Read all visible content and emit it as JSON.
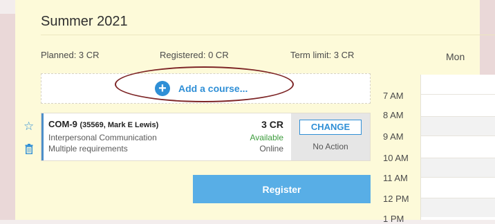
{
  "term": {
    "title": "Summer 2021",
    "planned": "Planned: 3 CR",
    "registered": "Registered: 0 CR",
    "term_limit": "Term limit: 3 CR"
  },
  "add_course": {
    "label": "Add a course..."
  },
  "course": {
    "code": "COM-9",
    "meta": "(35569, Mark E Lewis)",
    "name": "Interpersonal Communication",
    "requirements": "Multiple requirements",
    "credits": "3 CR",
    "availability": "Available",
    "mode": "Online",
    "change_label": "CHANGE",
    "action_status": "No Action"
  },
  "register": {
    "label": "Register"
  },
  "calendar": {
    "day_header": "Mon",
    "times": [
      "7 AM",
      "8 AM",
      "9 AM",
      "10 AM",
      "11 AM",
      "12 PM",
      "1 PM"
    ]
  },
  "icons": {
    "add": "plus-circle-icon",
    "favorite": "star-icon",
    "remove": "trash-icon"
  },
  "colors": {
    "accent": "#2f8fd6",
    "register": "#58aee6",
    "available": "#3b9b3b",
    "highlight": "#7d2526"
  }
}
